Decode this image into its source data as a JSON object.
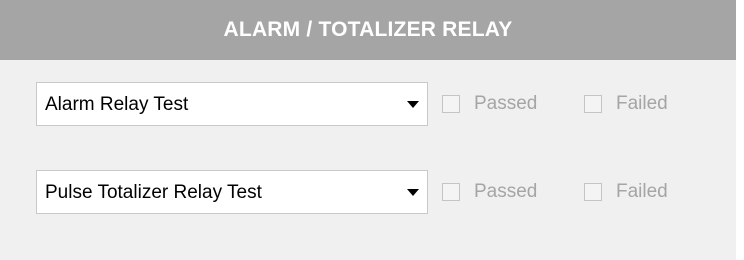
{
  "panel": {
    "title": "ALARM / TOTALIZER RELAY"
  },
  "rows": [
    {
      "select_value": "Alarm Relay Test",
      "passed_label": "Passed",
      "failed_label": "Failed",
      "passed_checked": false,
      "failed_checked": false
    },
    {
      "select_value": "Pulse Totalizer Relay Test",
      "passed_label": "Passed",
      "failed_label": "Failed",
      "passed_checked": false,
      "failed_checked": false
    }
  ],
  "icons": {
    "dropdown": "chevron-down-icon",
    "checkbox": "checkbox-icon"
  },
  "colors": {
    "header_bg": "#a5a5a5",
    "header_text": "#ffffff",
    "panel_bg": "#f0f0f0",
    "disabled_text": "#a5a5a5"
  }
}
